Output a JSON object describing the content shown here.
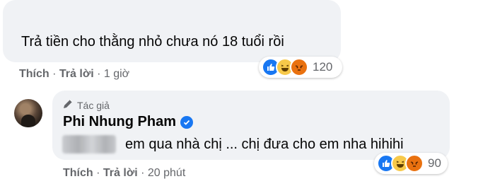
{
  "comment1": {
    "text": "Trả tiền cho thằng nhỏ chưa nó 18 tuổi rồi",
    "actions": {
      "like": "Thích",
      "reply": "Trả lời",
      "time": "1 giờ"
    },
    "reactions": {
      "icons": [
        "like-icon",
        "haha-icon",
        "angry-icon"
      ],
      "count": "120"
    }
  },
  "comment2": {
    "badge": "Tác giả",
    "author": "Phi Nhung Pham",
    "text": "em qua nhà chị ... chị đưa cho em nha hihihi",
    "actions": {
      "like": "Thích",
      "reply": "Trả lời",
      "time": "20 phút"
    },
    "reactions": {
      "icons": [
        "like-icon",
        "haha-icon",
        "angry-icon"
      ],
      "count": "90"
    }
  },
  "colors": {
    "bubble": "#f0f2f5",
    "secondary_text": "#65676b",
    "primary_text": "#050505",
    "brand_blue": "#1877f2"
  }
}
